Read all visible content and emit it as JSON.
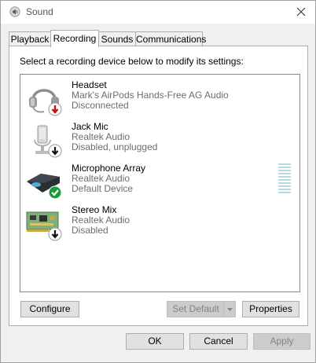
{
  "window": {
    "title": "Sound"
  },
  "tabs": [
    {
      "label": "Playback"
    },
    {
      "label": "Recording"
    },
    {
      "label": "Sounds"
    },
    {
      "label": "Communications"
    }
  ],
  "panel": {
    "instruction": "Select a recording device below to modify its settings:"
  },
  "devices": [
    {
      "name": "Headset",
      "line1": "Mark's AirPods Hands-Free AG Audio",
      "line2": "Disconnected",
      "icon": "headset-icon",
      "badge": "red-down-arrow"
    },
    {
      "name": "Jack Mic",
      "line1": "Realtek Audio",
      "line2": "Disabled, unplugged",
      "icon": "microphone-icon",
      "badge": "black-down-arrow"
    },
    {
      "name": "Microphone Array",
      "line1": "Realtek Audio",
      "line2": "Default Device",
      "icon": "microphone-array-icon",
      "badge": "green-check",
      "level": 0
    },
    {
      "name": "Stereo Mix",
      "line1": "Realtek Audio",
      "line2": "Disabled",
      "icon": "circuit-board-icon",
      "badge": "black-down-arrow"
    }
  ],
  "buttons": {
    "configure": "Configure",
    "set_default": "Set Default",
    "properties": "Properties",
    "ok": "OK",
    "cancel": "Cancel",
    "apply": "Apply"
  }
}
